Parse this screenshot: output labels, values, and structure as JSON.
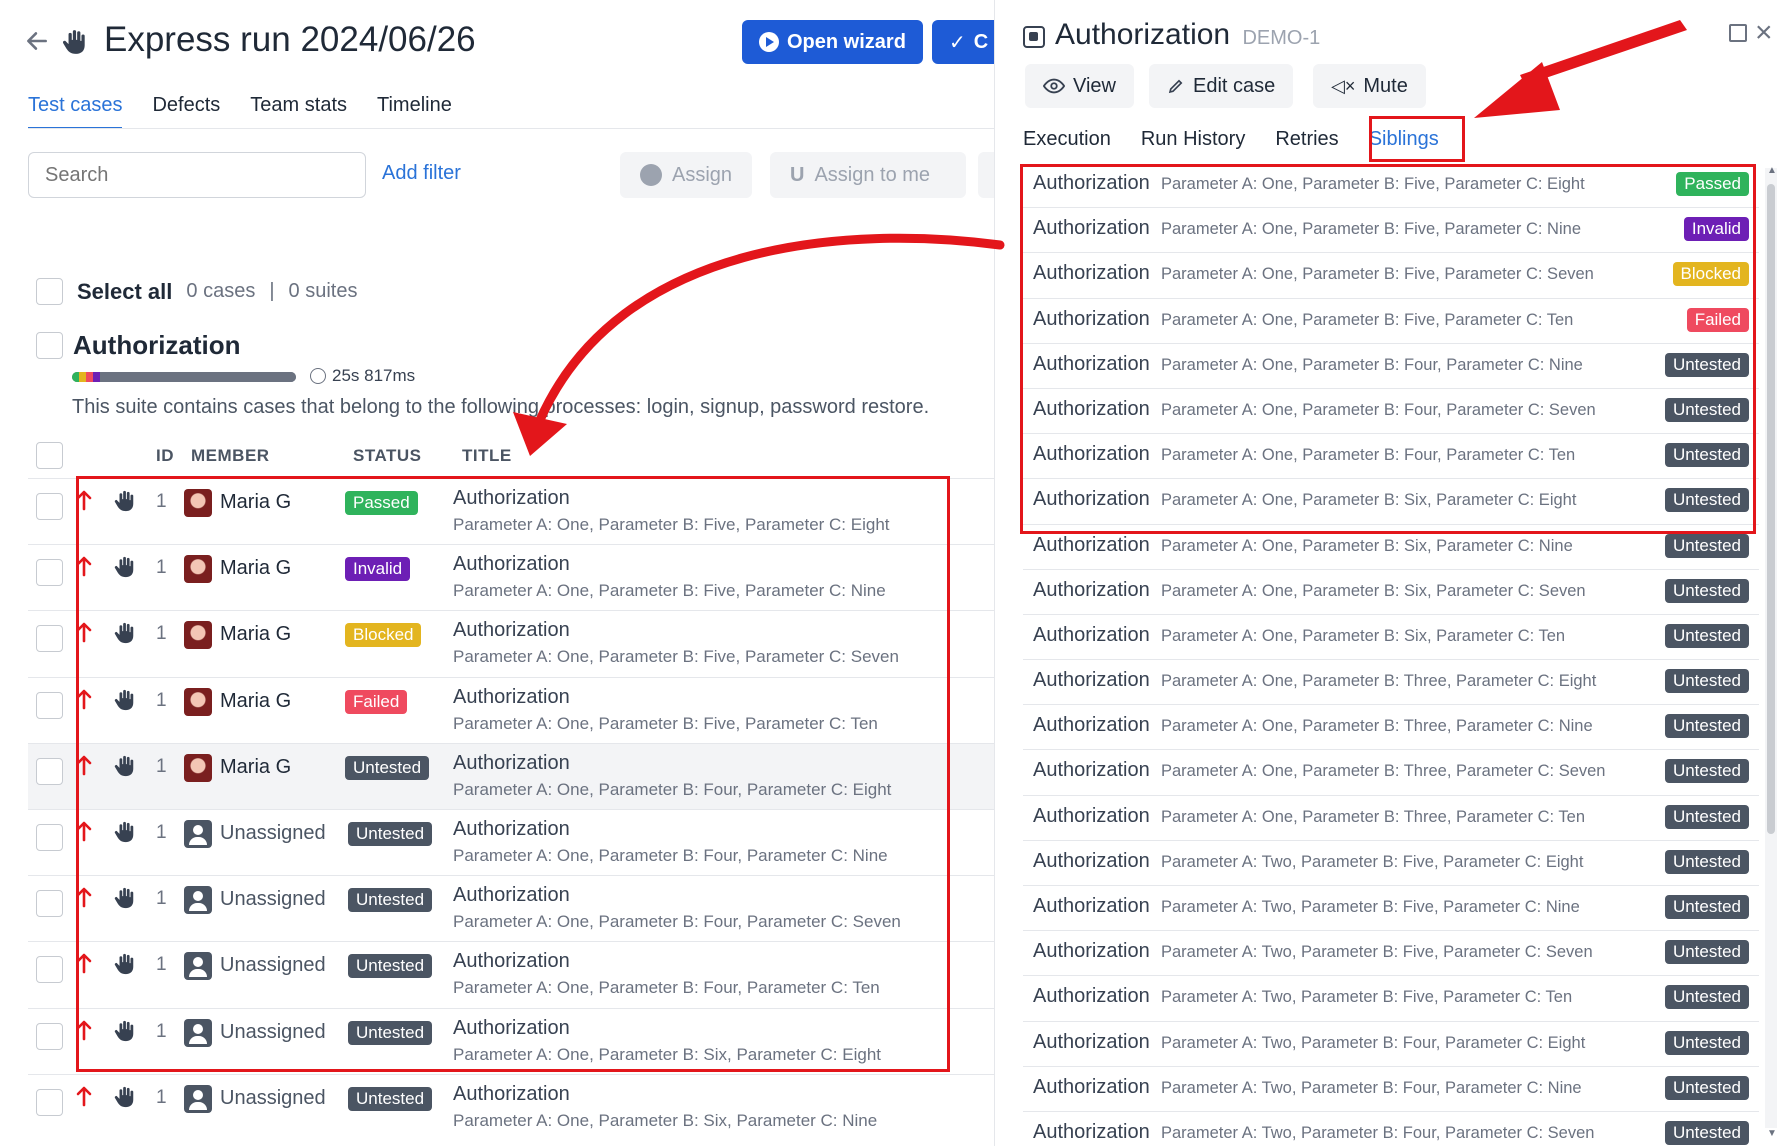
{
  "run": {
    "title": "Express run 2024/06/26",
    "open_wizard_label": "Open wizard",
    "second_button_label": "C"
  },
  "left_tabs": [
    "Test cases",
    "Defects",
    "Team stats",
    "Timeline"
  ],
  "search": {
    "placeholder": "Search"
  },
  "add_filter_label": "Add filter",
  "assign_label": "Assign",
  "assign_to_me_label": "Assign to me",
  "select_all": {
    "label": "Select all",
    "cases": "0 cases",
    "suites": "0 suites"
  },
  "suite": {
    "title": "Authorization",
    "duration": "25s 817ms",
    "description": "This suite contains cases that belong to the following processes: login, signup, password restore."
  },
  "table_headers": {
    "id": "ID",
    "member": "MEMBER",
    "status": "STATUS",
    "title": "TITLE"
  },
  "cases": [
    {
      "id": "1",
      "member": "Maria G",
      "status": "Passed",
      "title": "Authorization",
      "params": "Parameter A: One, Parameter B: Five, Parameter C: Eight"
    },
    {
      "id": "1",
      "member": "Maria G",
      "status": "Invalid",
      "title": "Authorization",
      "params": "Parameter A: One, Parameter B: Five, Parameter C: Nine"
    },
    {
      "id": "1",
      "member": "Maria G",
      "status": "Blocked",
      "title": "Authorization",
      "params": "Parameter A: One, Parameter B: Five, Parameter C: Seven"
    },
    {
      "id": "1",
      "member": "Maria G",
      "status": "Failed",
      "title": "Authorization",
      "params": "Parameter A: One, Parameter B: Five, Parameter C: Ten"
    },
    {
      "id": "1",
      "member": "Maria G",
      "status": "Untested",
      "title": "Authorization",
      "params": "Parameter A: One, Parameter B: Four, Parameter C: Eight"
    },
    {
      "id": "1",
      "member": "Unassigned",
      "status": "Untested",
      "title": "Authorization",
      "params": "Parameter A: One, Parameter B: Four, Parameter C: Nine"
    },
    {
      "id": "1",
      "member": "Unassigned",
      "status": "Untested",
      "title": "Authorization",
      "params": "Parameter A: One, Parameter B: Four, Parameter C: Seven"
    },
    {
      "id": "1",
      "member": "Unassigned",
      "status": "Untested",
      "title": "Authorization",
      "params": "Parameter A: One, Parameter B: Four, Parameter C: Ten"
    },
    {
      "id": "1",
      "member": "Unassigned",
      "status": "Untested",
      "title": "Authorization",
      "params": "Parameter A: One, Parameter B: Six, Parameter C: Eight"
    },
    {
      "id": "1",
      "member": "Unassigned",
      "status": "Untested",
      "title": "Authorization",
      "params": "Parameter A: One, Parameter B: Six, Parameter C: Nine"
    }
  ],
  "panel": {
    "title": "Authorization",
    "code": "DEMO-1",
    "view_label": "View",
    "edit_label": "Edit case",
    "mute_label": "Mute",
    "tabs": [
      "Execution",
      "Run History",
      "Retries",
      "Siblings"
    ]
  },
  "siblings": [
    {
      "name": "Authorization",
      "params": "Parameter A: One, Parameter B: Five, Parameter C: Eight",
      "status": "Passed"
    },
    {
      "name": "Authorization",
      "params": "Parameter A: One, Parameter B: Five, Parameter C: Nine",
      "status": "Invalid"
    },
    {
      "name": "Authorization",
      "params": "Parameter A: One, Parameter B: Five, Parameter C: Seven",
      "status": "Blocked"
    },
    {
      "name": "Authorization",
      "params": "Parameter A: One, Parameter B: Five, Parameter C: Ten",
      "status": "Failed"
    },
    {
      "name": "Authorization",
      "params": "Parameter A: One, Parameter B: Four, Parameter C: Nine",
      "status": "Untested"
    },
    {
      "name": "Authorization",
      "params": "Parameter A: One, Parameter B: Four, Parameter C: Seven",
      "status": "Untested"
    },
    {
      "name": "Authorization",
      "params": "Parameter A: One, Parameter B: Four, Parameter C: Ten",
      "status": "Untested"
    },
    {
      "name": "Authorization",
      "params": "Parameter A: One, Parameter B: Six, Parameter C: Eight",
      "status": "Untested"
    },
    {
      "name": "Authorization",
      "params": "Parameter A: One, Parameter B: Six, Parameter C: Nine",
      "status": "Untested"
    },
    {
      "name": "Authorization",
      "params": "Parameter A: One, Parameter B: Six, Parameter C: Seven",
      "status": "Untested"
    },
    {
      "name": "Authorization",
      "params": "Parameter A: One, Parameter B: Six, Parameter C: Ten",
      "status": "Untested"
    },
    {
      "name": "Authorization",
      "params": "Parameter A: One, Parameter B: Three, Parameter C: Eight",
      "status": "Untested"
    },
    {
      "name": "Authorization",
      "params": "Parameter A: One, Parameter B: Three, Parameter C: Nine",
      "status": "Untested"
    },
    {
      "name": "Authorization",
      "params": "Parameter A: One, Parameter B: Three, Parameter C: Seven",
      "status": "Untested"
    },
    {
      "name": "Authorization",
      "params": "Parameter A: One, Parameter B: Three, Parameter C: Ten",
      "status": "Untested"
    },
    {
      "name": "Authorization",
      "params": "Parameter A: Two, Parameter B: Five, Parameter C: Eight",
      "status": "Untested"
    },
    {
      "name": "Authorization",
      "params": "Parameter A: Two, Parameter B: Five, Parameter C: Nine",
      "status": "Untested"
    },
    {
      "name": "Authorization",
      "params": "Parameter A: Two, Parameter B: Five, Parameter C: Seven",
      "status": "Untested"
    },
    {
      "name": "Authorization",
      "params": "Parameter A: Two, Parameter B: Five, Parameter C: Ten",
      "status": "Untested"
    },
    {
      "name": "Authorization",
      "params": "Parameter A: Two, Parameter B: Four, Parameter C: Eight",
      "status": "Untested"
    },
    {
      "name": "Authorization",
      "params": "Parameter A: Two, Parameter B: Four, Parameter C: Nine",
      "status": "Untested"
    },
    {
      "name": "Authorization",
      "params": "Parameter A: Two, Parameter B: Four, Parameter C: Seven",
      "status": "Untested"
    }
  ],
  "status_colors": {
    "Passed": "#2fb35c",
    "Invalid": "#6d1fb5",
    "Blocked": "#e3b51f",
    "Failed": "#ef4a5f",
    "Untested": "#4b5563"
  },
  "colors": {
    "accent": "#1e5bd6",
    "link": "#2a73d8",
    "annotation": "#e3161b"
  },
  "suite_bar_colors": [
    "#2fb35c",
    "#e3b51f",
    "#ef4a5f",
    "#6d1fb5",
    "#6b7280"
  ]
}
